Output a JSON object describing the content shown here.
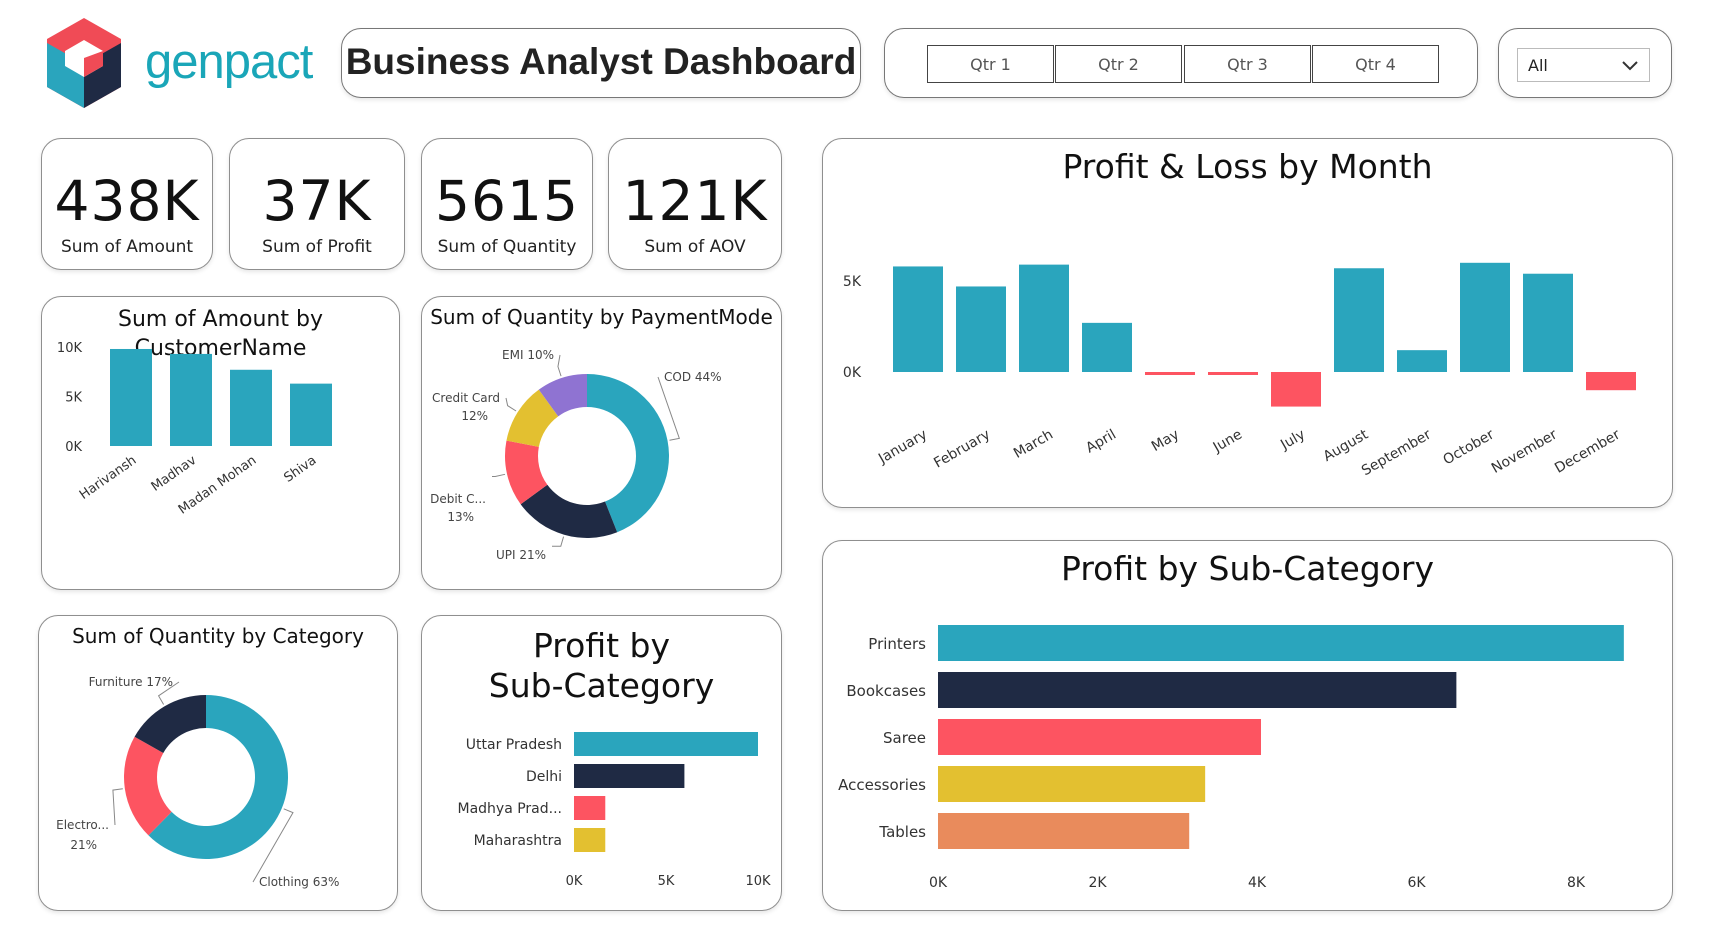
{
  "brand": {
    "name": "genpact"
  },
  "header": {
    "title": "Business Analyst Dashboard"
  },
  "quarters": [
    "Qtr 1",
    "Qtr 2",
    "Qtr 3",
    "Qtr 4"
  ],
  "dropdown": {
    "selected": "All"
  },
  "kpis": [
    {
      "value": "438K",
      "label": "Sum of Amount"
    },
    {
      "value": "37K",
      "label": "Sum of Profit"
    },
    {
      "value": "5615",
      "label": "Sum of Quantity"
    },
    {
      "value": "121K",
      "label": "Sum of AOV"
    }
  ],
  "colors": {
    "teal": "#2aa5bd",
    "navy": "#1f2a44",
    "coral": "#fd5461",
    "yellow": "#e3c030",
    "purple": "#8f73d2",
    "orange": "#e98b5c"
  },
  "chart_data": [
    {
      "id": "amount_by_customer",
      "type": "bar",
      "title": "Sum of Amount by CustomerName",
      "categories": [
        "Harivansh",
        "Madhav",
        "Madan Mohan",
        "Shiva"
      ],
      "values": [
        9800,
        9300,
        7700,
        6300
      ],
      "ylim": [
        0,
        10000
      ],
      "yticks": [
        "0K",
        "5K",
        "10K"
      ],
      "color": "#2aa5bd"
    },
    {
      "id": "quantity_by_paymentmode",
      "type": "pie",
      "title": "Sum of Quantity by PaymentMode",
      "donut": true,
      "slices": [
        {
          "label": "COD 44%",
          "value": 44,
          "color": "#2aa5bd"
        },
        {
          "label": "UPI 21%",
          "value": 21,
          "color": "#1f2a44"
        },
        {
          "label": "Debit C...",
          "pct": "13%",
          "value": 13,
          "color": "#fd5461"
        },
        {
          "label": "Credit Card",
          "pct": "12%",
          "value": 12,
          "color": "#e3c030"
        },
        {
          "label": "EMI 10%",
          "value": 10,
          "color": "#8f73d2"
        }
      ]
    },
    {
      "id": "quantity_by_category",
      "type": "pie",
      "title": "Sum of Quantity by Category",
      "donut": true,
      "slices": [
        {
          "label": "Clothing 63%",
          "value": 63,
          "color": "#2aa5bd"
        },
        {
          "label": "Electro...",
          "pct": "21%",
          "value": 21,
          "color": "#fd5461"
        },
        {
          "label": "Furniture 17%",
          "value": 17,
          "color": "#1f2a44"
        }
      ]
    },
    {
      "id": "profit_by_state",
      "type": "bar",
      "orientation": "horizontal",
      "title_lines": [
        "Profit by",
        "Sub-Category"
      ],
      "categories": [
        "Uttar Pradesh",
        "Delhi",
        "Madhya Prad...",
        "Maharashtra"
      ],
      "values": [
        10000,
        6000,
        1700,
        1700
      ],
      "colors": [
        "#2aa5bd",
        "#1f2a44",
        "#fd5461",
        "#e3c030"
      ],
      "xlim": [
        0,
        10000
      ],
      "xticks": [
        "0K",
        "5K",
        "10K"
      ]
    },
    {
      "id": "pl_by_month",
      "type": "bar",
      "title": "Profit & Loss by Month",
      "categories": [
        "January",
        "February",
        "March",
        "April",
        "May",
        "June",
        "July",
        "August",
        "September",
        "October",
        "November",
        "December"
      ],
      "values": [
        5800,
        4700,
        5900,
        2700,
        -100,
        -150,
        -1900,
        5700,
        1200,
        6000,
        5400,
        -1000
      ],
      "ylim": [
        -2000,
        7000
      ],
      "yticks": [
        "0K",
        "5K"
      ],
      "positive_color": "#2aa5bd",
      "negative_color": "#fd5461"
    },
    {
      "id": "profit_by_subcategory",
      "type": "bar",
      "orientation": "horizontal",
      "title": "Profit by Sub-Category",
      "categories": [
        "Printers",
        "Bookcases",
        "Saree",
        "Accessories",
        "Tables"
      ],
      "values": [
        8600,
        6500,
        4050,
        3350,
        3150
      ],
      "colors": [
        "#2aa5bd",
        "#1f2a44",
        "#fd5461",
        "#e3c030",
        "#e98b5c"
      ],
      "xlim": [
        0,
        9000
      ],
      "xticks": [
        "0K",
        "2K",
        "4K",
        "6K",
        "8K"
      ]
    }
  ]
}
